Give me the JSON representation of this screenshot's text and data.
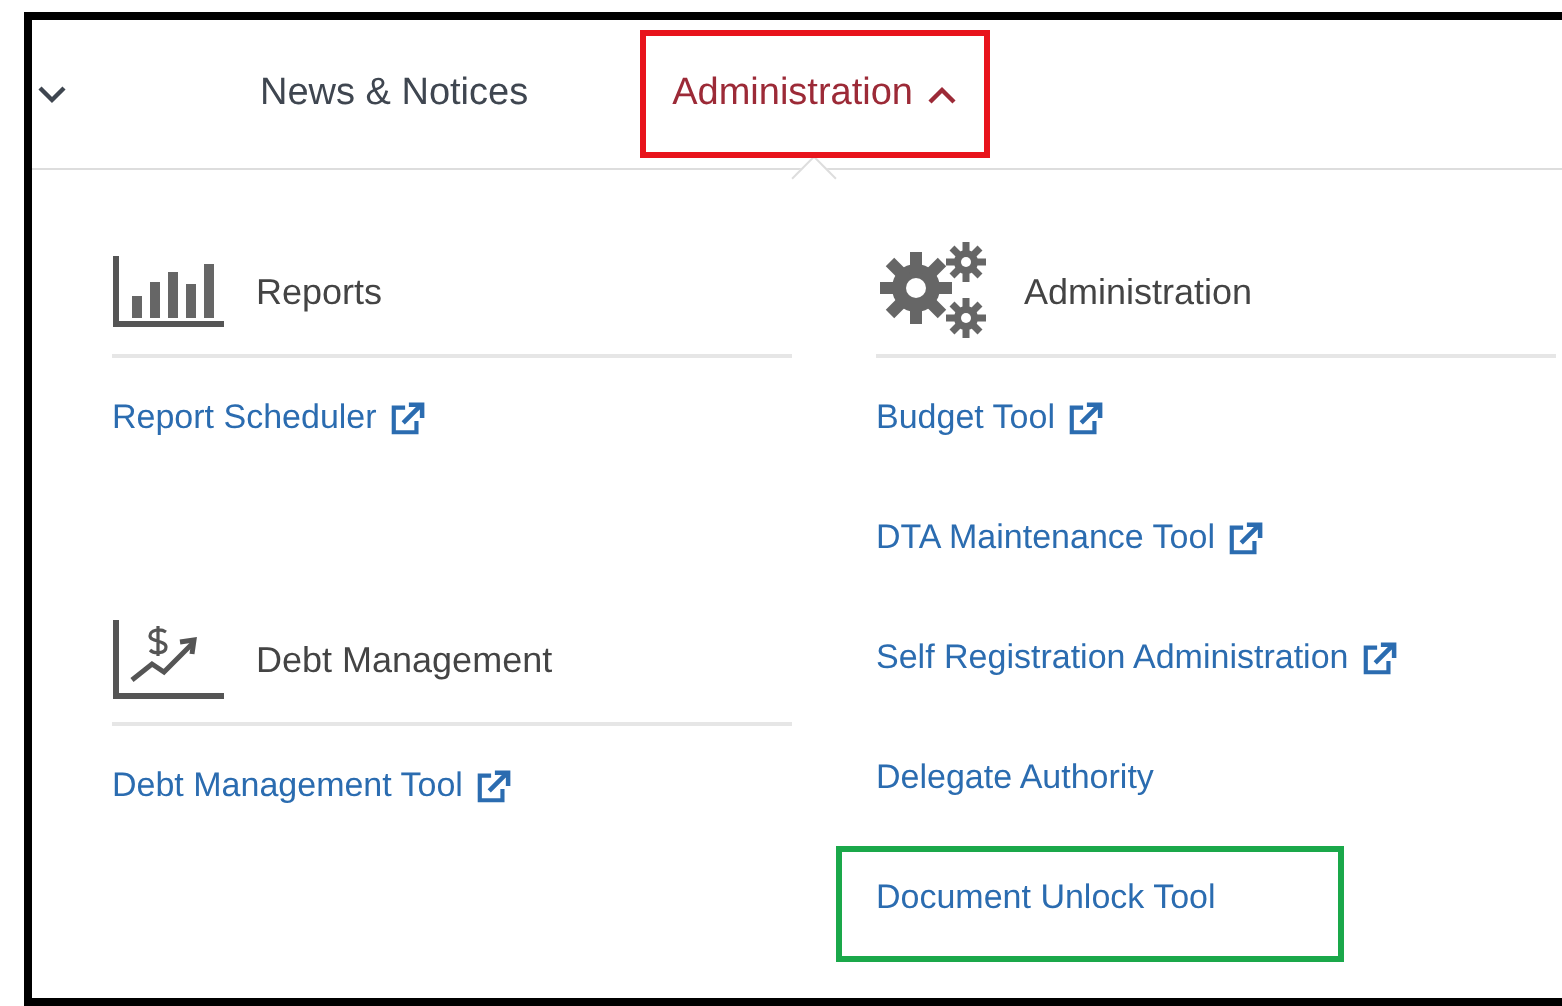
{
  "nav": {
    "items": [
      {
        "kind": "chevron",
        "selected": false,
        "expanded": false
      },
      {
        "kind": "text",
        "label": "News & Notices",
        "selected": false
      },
      {
        "kind": "text",
        "label": "Administration",
        "selected": true,
        "expanded": true,
        "color": "#e8141c"
      }
    ]
  },
  "menu": {
    "columns": [
      {
        "sections": [
          {
            "kind": "reports",
            "title": "Reports",
            "links": [
              {
                "label": "Report Scheduler",
                "external": true
              }
            ]
          },
          {
            "kind": "debt",
            "title": "Debt Management",
            "links": [
              {
                "label": "Debt Management Tool",
                "external": true
              }
            ]
          }
        ]
      },
      {
        "sections": [
          {
            "kind": "admin",
            "title": "Administration",
            "links": [
              {
                "label": "Budget Tool",
                "external": true
              },
              {
                "label": "DTA Maintenance Tool",
                "external": true
              },
              {
                "label": "Self Registration Administration",
                "external": true
              },
              {
                "label": "Delegate Authority",
                "external": false
              },
              {
                "label": "Document Unlock Tool",
                "external": false,
                "color": "#1aa84a"
              }
            ]
          }
        ]
      }
    ]
  }
}
